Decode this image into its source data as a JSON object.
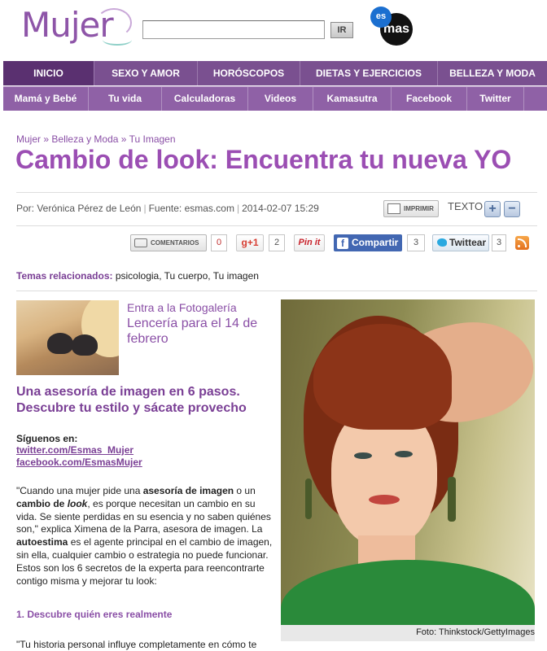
{
  "header": {
    "logo_text": "Mujer",
    "search_placeholder": "",
    "search_button": "IR",
    "partner_logo_top": "es",
    "partner_logo_bottom": "mas"
  },
  "nav_primary": [
    {
      "label": "INICIO",
      "active": true
    },
    {
      "label": "SEXO Y AMOR"
    },
    {
      "label": "HORÓSCOPOS"
    },
    {
      "label": "DIETAS Y EJERCICIOS"
    },
    {
      "label": "BELLEZA Y MODA"
    }
  ],
  "nav_secondary": [
    {
      "label": "Mamá y Bebé"
    },
    {
      "label": "Tu vida"
    },
    {
      "label": "Calculadoras"
    },
    {
      "label": "Videos"
    },
    {
      "label": "Kamasutra"
    },
    {
      "label": "Facebook"
    },
    {
      "label": "Twitter"
    }
  ],
  "breadcrumb": [
    "Mujer",
    "Belleza y Moda",
    "Tu Imagen"
  ],
  "breadcrumb_separator": "»",
  "article": {
    "title": "Cambio de look: Encuentra tu nueva YO",
    "author": "Por: Verónica Pérez de León",
    "source": "Fuente: esmas.com",
    "date": "2014-02-07 15:29"
  },
  "tools": {
    "print_label": "IMPRIMIR",
    "text_label": "TEXTO",
    "increase": "+",
    "decrease": "−"
  },
  "social": {
    "comments_label": "COMENTARIOS",
    "comments_count": "0",
    "gplus_label": "g+1",
    "gplus_count": "2",
    "pinterest_label": "Pin it",
    "facebook_label": "Compartir",
    "facebook_count": "3",
    "twitter_label": "Twittear",
    "twitter_count": "3"
  },
  "related": {
    "label": "Temas relacionados:",
    "topics": "psicologia, Tu cuerpo, Tu imagen"
  },
  "gallery": {
    "label": "Entra a la Fotogalería",
    "title": "Lencería para el 14 de febrero"
  },
  "subheading": "Una asesoría de imagen en 6 pasos. Descubre tu estilo y sácate provecho",
  "follow": {
    "label": "Síguenos en:",
    "twitter": "twitter.com/Esmas_Mujer",
    "facebook": "facebook.com/EsmasMujer"
  },
  "body": {
    "p1_a": "\"Cuando una mujer pide una ",
    "p1_b": "asesoría de imagen",
    "p1_c": " o un ",
    "p1_d": "cambio de ",
    "p1_e": "look",
    "p1_f": ", es porque necesitan un cambio en su vida. Se siente perdidas en su esencia y no saben quiénes son,\" explica Ximena de la Parra, asesora de imagen. La ",
    "p1_g": "autoestima",
    "p1_h": " es el agente principal en el cambio de imagen, sin ella, cualquier cambio o estrategia no puede funcionar. Estos son los 6 secretos de la experta para reencontrarte contigo misma y mejorar tu look:",
    "section1": "1. Descubre quién eres realmente",
    "p2": "\"Tu historia personal influye completamente en cómo te"
  },
  "photo_credit": "Foto: Thinkstock/GettyImages",
  "colors": {
    "brand_purple": "#8a4fa6",
    "nav_dark": "#7a5090",
    "nav_light": "#8f61a6",
    "facebook_blue": "#4267b2"
  }
}
